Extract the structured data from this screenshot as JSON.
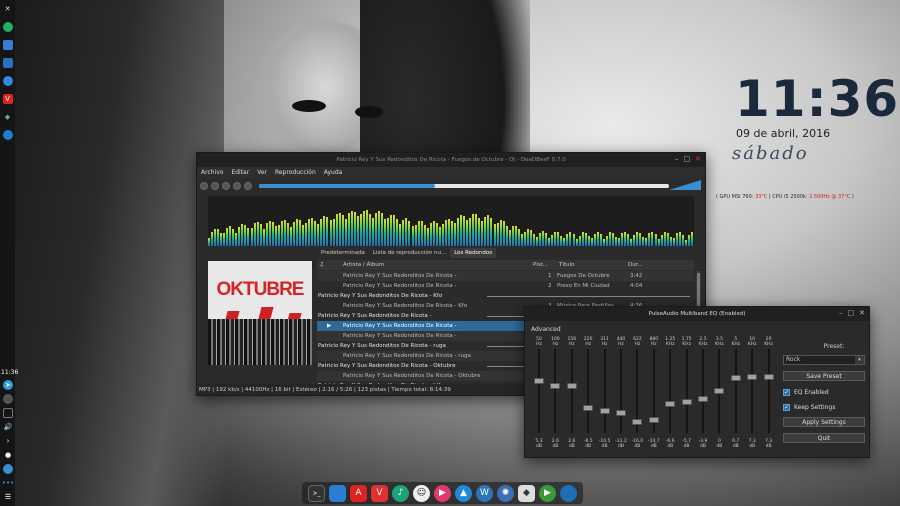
{
  "desktop": {
    "clock_time": "11:36",
    "clock_date": "09 de abril, 2016",
    "clock_day": "sábado",
    "sys_info_gpu": "( GPU MSI 760: ",
    "sys_info_gpu_temp": "33°C",
    "sys_info_cpu": " | CPU i5 2500k: ",
    "sys_info_cpu_freq": "2.500Hz @ 37°C",
    "sys_info_end": " )",
    "left_panel_clock": "11:36"
  },
  "player": {
    "title": "Patricio Rey Y Sus Redonditos De Ricota - Fuegos de Octubre - Qt - DeaDBeeF 0.7.0",
    "menu": [
      "Archivo",
      "Editar",
      "Ver",
      "Reproducción",
      "Ayuda"
    ],
    "progress": 0.43,
    "tabs": [
      "Predeterminada",
      "Lista de reproducción nu...",
      "Los Redondos"
    ],
    "columns": {
      "playing": "♫",
      "artist": "Artista / Álbum",
      "track": "Pist...",
      "title": "Título",
      "duration": "Dur..."
    },
    "rows": [
      {
        "type": "track",
        "artist": "Patricio Rey Y Sus Redonditos De Ricota -",
        "track": "1",
        "title": "Fuegos De Octubre",
        "duration": "3:42"
      },
      {
        "type": "track",
        "artist": "Patricio Rey Y Sus Redonditos De Ricota -",
        "track": "2",
        "title": "Preso En Mi Ciudad",
        "duration": "4:04"
      },
      {
        "type": "group",
        "artist": "Patricio Rey Y Sus Redonditos De Ricota - Kfo",
        "track": "",
        "title": "",
        "duration": ""
      },
      {
        "type": "track",
        "artist": "Patricio Rey Y Sus Redonditos De Ricota - Kfo",
        "track": "3",
        "title": "Música Para Pastillas",
        "duration": "4:36"
      },
      {
        "type": "group",
        "artist": "Patricio Rey Y Sus Redonditos De Ricota -",
        "track": "",
        "title": "",
        "duration": ""
      },
      {
        "type": "selected",
        "artist": "Patricio Rey Y Sus Redonditos De Ricota -",
        "track": "",
        "title": "",
        "duration": ""
      },
      {
        "type": "track",
        "artist": "Patricio Rey Y Sus Redonditos De Ricota -",
        "track": "",
        "title": "",
        "duration": ""
      },
      {
        "type": "group",
        "artist": "Patricio Rey Y Sus Redonditos De Ricota - ruga",
        "track": "",
        "title": "",
        "duration": ""
      },
      {
        "type": "track",
        "artist": "Patricio Rey Y Sus Redonditos De Ricota - ruga",
        "track": "",
        "title": "",
        "duration": ""
      },
      {
        "type": "group",
        "artist": "Patricio Rey Y Sus Redonditos De Ricota - Oktubre",
        "track": "",
        "title": "",
        "duration": ""
      },
      {
        "type": "track",
        "artist": "Patricio Rey Y Sus Redonditos De Ricota - Oktubre",
        "track": "",
        "title": "",
        "duration": ""
      },
      {
        "type": "group",
        "artist": "Patricio Rey Y Sus Redonditos De Ricota - hKa",
        "track": "",
        "title": "",
        "duration": ""
      }
    ],
    "album_cover_title": "OKTUBRE",
    "status": "MP3 | 192 kb/s | 44100Hz | 16 bit | Estéreo | 2:16 / 5:26 | 123 pistas | Tiempo total: 8:14:39"
  },
  "eq": {
    "title": "PulseAudio Multiband EQ (Enabled)",
    "advanced_label": "Advanced",
    "bands": [
      {
        "freq": "50",
        "unit": "Hz",
        "value": "5.3",
        "db": "dB",
        "level": 5.3
      },
      {
        "freq": "100",
        "unit": "Hz",
        "value": "2.6",
        "db": "dB",
        "level": 2.6
      },
      {
        "freq": "156",
        "unit": "Hz",
        "value": "2.6",
        "db": "dB",
        "level": 2.6
      },
      {
        "freq": "220",
        "unit": "Hz",
        "value": "-8.5",
        "db": "dB",
        "level": -8.5
      },
      {
        "freq": "311",
        "unit": "Hz",
        "value": "-10.5",
        "db": "dB",
        "level": -10.5
      },
      {
        "freq": "440",
        "unit": "Hz",
        "value": "-11.2",
        "db": "dB",
        "level": -11.2
      },
      {
        "freq": "622",
        "unit": "Hz",
        "value": "-16.0",
        "db": "dB",
        "level": -16.0
      },
      {
        "freq": "880",
        "unit": "Hz",
        "value": "-14.7",
        "db": "dB",
        "level": -14.7
      },
      {
        "freq": "1.25",
        "unit": "KHz",
        "value": "-6.6",
        "db": "dB",
        "level": -6.6
      },
      {
        "freq": "1.75",
        "unit": "KHz",
        "value": "-5.7",
        "db": "dB",
        "level": -5.7
      },
      {
        "freq": "2.5",
        "unit": "KHz",
        "value": "-3.9",
        "db": "dB",
        "level": -3.9
      },
      {
        "freq": "3.5",
        "unit": "KHz",
        "value": "0",
        "db": "dB",
        "level": 0
      },
      {
        "freq": "5",
        "unit": "KHz",
        "value": "6.7",
        "db": "dB",
        "level": 6.7
      },
      {
        "freq": "10",
        "unit": "KHz",
        "value": "7.3",
        "db": "dB",
        "level": 7.3
      },
      {
        "freq": "20",
        "unit": "KHz",
        "value": "7.3",
        "db": "dB",
        "level": 7.3
      }
    ],
    "preset_label": "Preset:",
    "preset_value": "Rock",
    "save_preset": "Save Preset",
    "eq_enabled": "EQ Enabled",
    "keep_settings": "Keep Settings",
    "apply_settings": "Apply Settings",
    "quit": "Quit"
  },
  "colors": {
    "accent": "#3a8fd0",
    "selection": "#2d6a9a",
    "cover_red": "#d42424"
  },
  "left_panel_icons": [
    "logo-icon",
    "green-app-icon",
    "files-icon",
    "folder-icon",
    "blue-dot-icon",
    "vivaldi-icon",
    "green-tool-icon",
    "blue-app-icon"
  ],
  "left_panel_tray": [
    "telegram-icon",
    "steam-icon",
    "network-icon",
    "volume-icon",
    "chevron-right-icon",
    "drop-icon",
    "globe-icon",
    "dots-icon",
    "menu-icon"
  ],
  "dock_icons": [
    "terminal-icon",
    "file-icon",
    "acrobat-icon",
    "vivaldi-icon",
    "music-icon",
    "penguin-icon",
    "play-icon",
    "triangle-icon",
    "wordpress-icon",
    "atom-icon",
    "origami-icon",
    "play-circle-icon",
    "steam-icon"
  ]
}
